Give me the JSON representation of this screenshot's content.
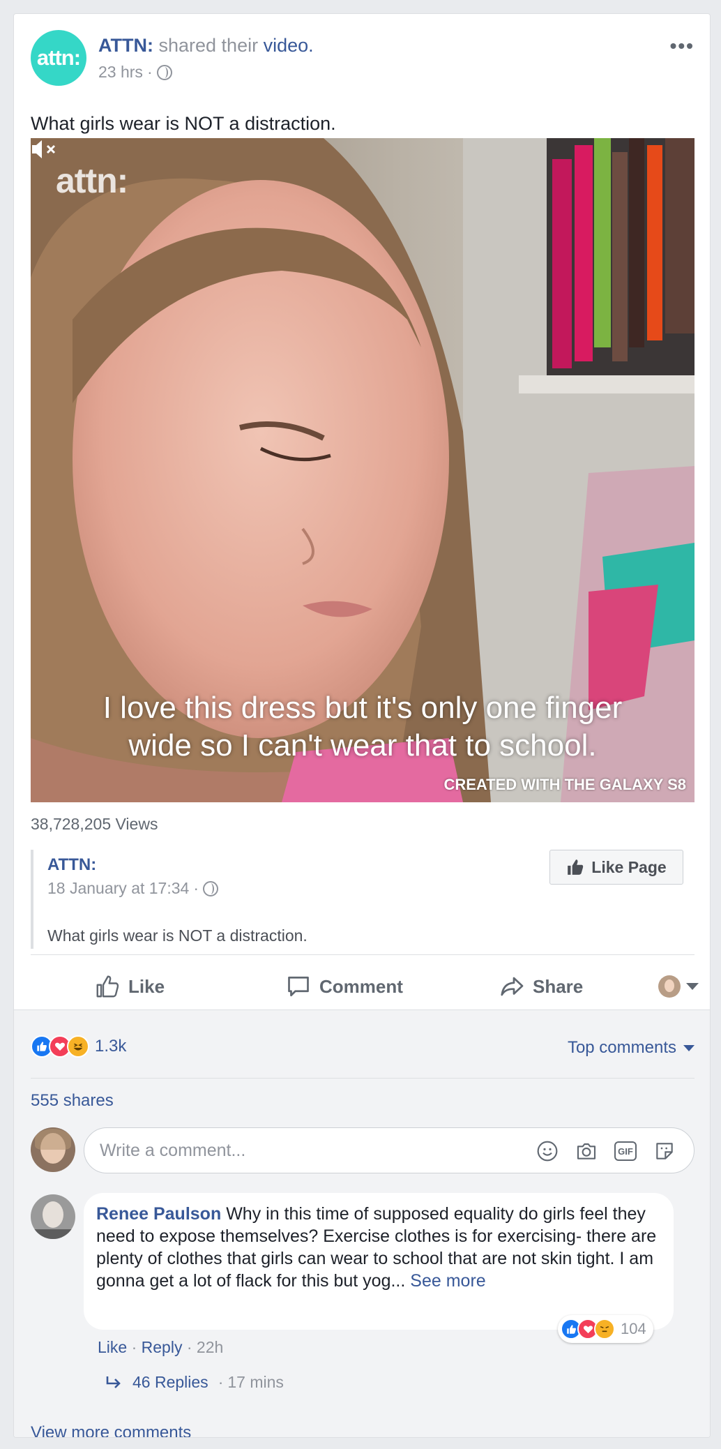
{
  "post": {
    "avatar_text": "attn:",
    "author": "ATTN:",
    "shared_text": "shared their",
    "shared_object": "video.",
    "time": "23 hrs",
    "text": "What girls wear is NOT a distraction.",
    "more_label": "•••"
  },
  "video": {
    "watermark": "attn:",
    "caption_line1": "I love this dress but it's only one finger",
    "caption_line2": "wide so I can't wear that to school.",
    "credit": "CREATED WITH THE GALAXY S8",
    "views": "38,728,205 Views"
  },
  "shared_post": {
    "author": "ATTN:",
    "date": "18 January at 17:34",
    "text": "What girls wear is NOT a distraction.",
    "like_page_label": "Like Page"
  },
  "actions": {
    "like": "Like",
    "comment": "Comment",
    "share": "Share"
  },
  "stats": {
    "reaction_count": "1.3k",
    "top_comments_label": "Top comments",
    "shares": "555 shares"
  },
  "composer": {
    "placeholder": "Write a comment...",
    "gif_label": "GIF"
  },
  "comment": {
    "author": "Renee Paulson",
    "text": "Why in this time of supposed equality do girls feel they need to expose themselves? Exercise clothes is for exercising- there are plenty of clothes that girls can wear to school that are not skin tight. I am gonna get a lot of flack for this but yog...",
    "see_more": "See more",
    "like": "Like",
    "reply": "Reply",
    "time": "22h",
    "reaction_count": "104",
    "replies_label": "46 Replies",
    "replies_time": "17 mins"
  },
  "view_more_label": "View more comments",
  "colors": {
    "link": "#385898",
    "like_blue": "#1877f2",
    "love_red": "#f33e58",
    "haha_yellow": "#f7b125",
    "brand_teal": "#35d7c7"
  }
}
